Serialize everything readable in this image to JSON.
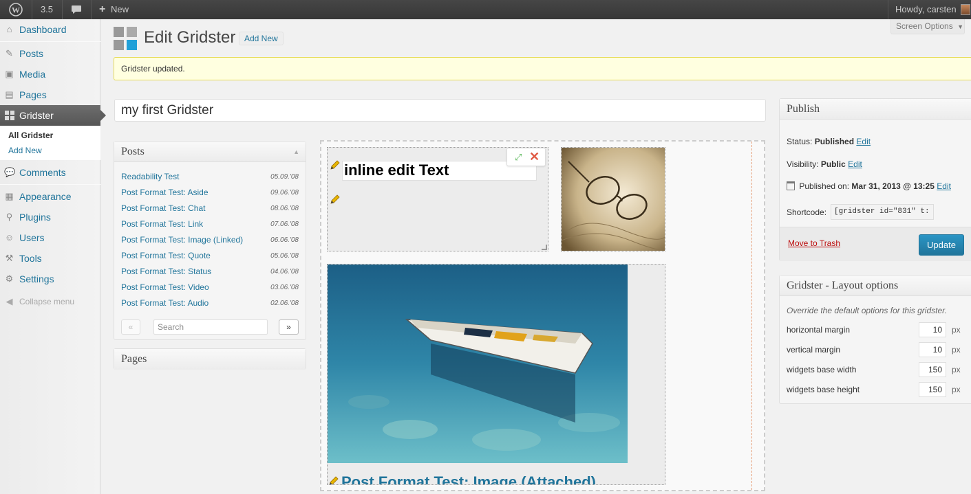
{
  "adminbar": {
    "version": "3.5",
    "new_label": "New",
    "howdy": "Howdy, carsten"
  },
  "screen_options": "Screen Options",
  "menu": {
    "dashboard": "Dashboard",
    "posts": "Posts",
    "media": "Media",
    "pages": "Pages",
    "gridster": "Gridster",
    "gridster_sub": [
      "All Gridster",
      "Add New"
    ],
    "comments": "Comments",
    "appearance": "Appearance",
    "plugins": "Plugins",
    "users": "Users",
    "tools": "Tools",
    "settings": "Settings",
    "collapse": "Collapse menu"
  },
  "header": {
    "title": "Edit Gridster",
    "add_new": "Add New"
  },
  "notice": "Gridster updated.",
  "post_title": "my first Gridster",
  "posts_box": {
    "title": "Posts",
    "items": [
      {
        "title": "Readability Test",
        "date": "05.09.'08"
      },
      {
        "title": "Post Format Test: Aside",
        "date": "09.06.'08"
      },
      {
        "title": "Post Format Test: Chat",
        "date": "08.06.'08"
      },
      {
        "title": "Post Format Test: Link",
        "date": "07.06.'08"
      },
      {
        "title": "Post Format Test: Image (Linked)",
        "date": "06.06.'08"
      },
      {
        "title": "Post Format Test: Quote",
        "date": "05.06.'08"
      },
      {
        "title": "Post Format Test: Status",
        "date": "04.06.'08"
      },
      {
        "title": "Post Format Test: Video",
        "date": "03.06.'08"
      },
      {
        "title": "Post Format Test: Audio",
        "date": "02.06.'08"
      }
    ],
    "prev": "«",
    "next": "»",
    "search_placeholder": "Search"
  },
  "pages_box": {
    "title": "Pages"
  },
  "grid": {
    "inline_text": "inline edit Text",
    "post_caption": "Post Format Test: Image (Attached)"
  },
  "publish": {
    "title": "Publish",
    "status_label": "Status:",
    "status_value": "Published",
    "visibility_label": "Visibility:",
    "visibility_value": "Public",
    "published_label": "Published on:",
    "published_value": "Mar 31, 2013 @ 13:25",
    "edit": "Edit",
    "shortcode_label": "Shortcode:",
    "shortcode_value": "[gridster id=\"831\" t:",
    "trash": "Move to Trash",
    "update": "Update"
  },
  "layout_box": {
    "title": "Gridster - Layout options",
    "desc": "Override the default options for this gridster.",
    "unit": "px",
    "fields": [
      {
        "label": "horizontal margin",
        "value": "10"
      },
      {
        "label": "vertical margin",
        "value": "10"
      },
      {
        "label": "widgets base width",
        "value": "150"
      },
      {
        "label": "widgets base height",
        "value": "150"
      }
    ]
  }
}
